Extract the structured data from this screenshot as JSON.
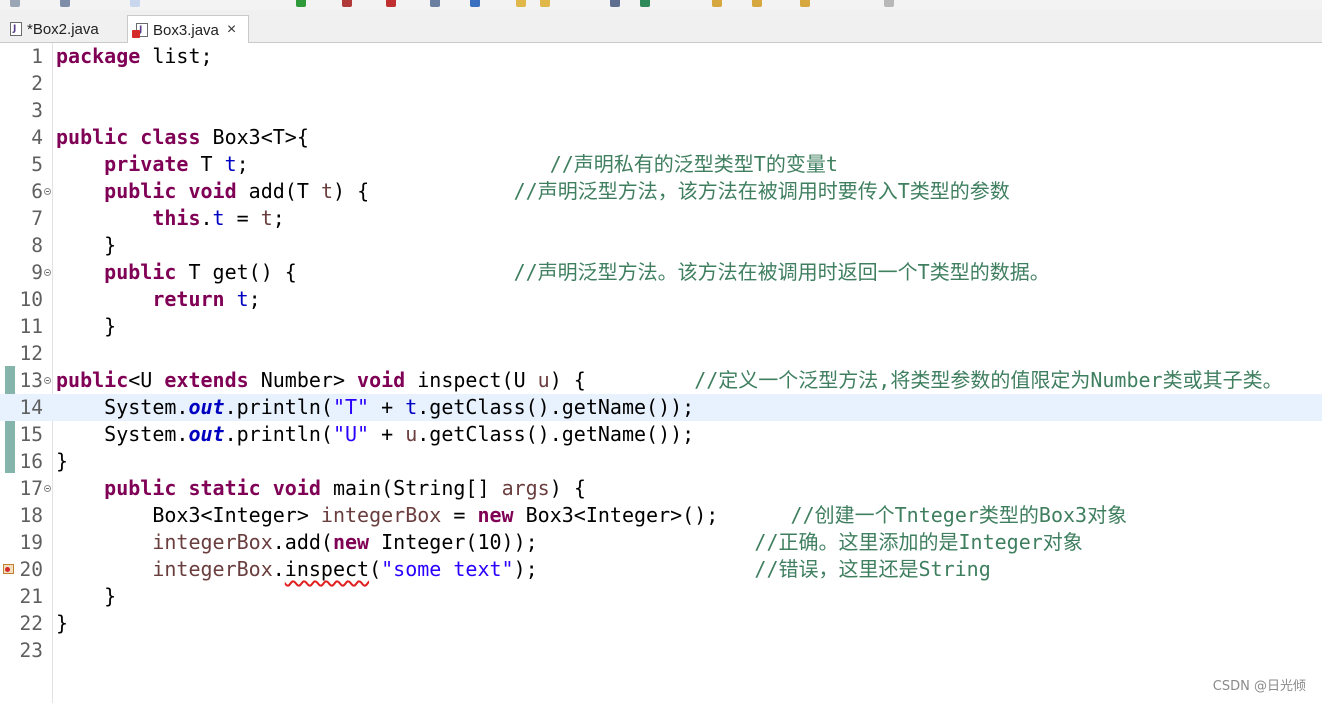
{
  "tabs": [
    {
      "label": "*Box2.java",
      "active": false
    },
    {
      "label": "Box3.java",
      "active": true,
      "close": "×"
    }
  ],
  "watermark": "CSDN @日光倾",
  "colors": {
    "keyword": "#7f0055",
    "comment": "#3f7f5f",
    "string": "#2a00ff",
    "field": "#0000c0",
    "current_line": "#e8f2fe"
  },
  "editor": {
    "lines": [
      {
        "n": "1",
        "code": [
          {
            "t": "package",
            "c": "kw"
          },
          {
            "t": " list;"
          }
        ]
      },
      {
        "n": "2",
        "code": []
      },
      {
        "n": "3",
        "code": []
      },
      {
        "n": "4",
        "code": [
          {
            "t": "public",
            "c": "kw"
          },
          {
            "t": " "
          },
          {
            "t": "class",
            "c": "kw"
          },
          {
            "t": " Box3<T>{"
          }
        ]
      },
      {
        "n": "5",
        "code": [
          {
            "t": "    "
          },
          {
            "t": "private",
            "c": "kw"
          },
          {
            "t": " T "
          },
          {
            "t": "t",
            "c": "field"
          },
          {
            "t": ";                         "
          },
          {
            "t": "//声明私有的泛型类型T的变量t",
            "c": "cmt"
          }
        ]
      },
      {
        "n": "6",
        "fold": true,
        "code": [
          {
            "t": "    "
          },
          {
            "t": "public",
            "c": "kw"
          },
          {
            "t": " "
          },
          {
            "t": "void",
            "c": "kw"
          },
          {
            "t": " add(T "
          },
          {
            "t": "t",
            "c": "local"
          },
          {
            "t": ") {            "
          },
          {
            "t": "//声明泛型方法，该方法在被调用时要传入T类型的参数",
            "c": "cmt"
          }
        ]
      },
      {
        "n": "7",
        "code": [
          {
            "t": "        "
          },
          {
            "t": "this",
            "c": "kw"
          },
          {
            "t": "."
          },
          {
            "t": "t",
            "c": "field"
          },
          {
            "t": " = "
          },
          {
            "t": "t",
            "c": "local"
          },
          {
            "t": ";"
          }
        ]
      },
      {
        "n": "8",
        "code": [
          {
            "t": "    }"
          }
        ]
      },
      {
        "n": "9",
        "fold": true,
        "code": [
          {
            "t": "    "
          },
          {
            "t": "public",
            "c": "kw"
          },
          {
            "t": " T get() {                  "
          },
          {
            "t": "//声明泛型方法。该方法在被调用时返回一个T类型的数据。",
            "c": "cmt"
          }
        ]
      },
      {
        "n": "10",
        "code": [
          {
            "t": "        "
          },
          {
            "t": "return",
            "c": "kw"
          },
          {
            "t": " "
          },
          {
            "t": "t",
            "c": "field"
          },
          {
            "t": ";"
          }
        ]
      },
      {
        "n": "11",
        "code": [
          {
            "t": "    }"
          }
        ]
      },
      {
        "n": "12",
        "code": []
      },
      {
        "n": "13",
        "fold": true,
        "code": [
          {
            "t": "public",
            "c": "kw"
          },
          {
            "t": "<U "
          },
          {
            "t": "extends",
            "c": "kw"
          },
          {
            "t": " Number> "
          },
          {
            "t": "void",
            "c": "kw"
          },
          {
            "t": " inspect(U "
          },
          {
            "t": "u",
            "c": "local"
          },
          {
            "t": ") {         "
          },
          {
            "t": "//定义一个泛型方法,将类型参数的值限定为Number类或其子类。",
            "c": "cmt"
          }
        ]
      },
      {
        "n": "14",
        "current": true,
        "code": [
          {
            "t": "    System."
          },
          {
            "t": "out",
            "c": "sfield"
          },
          {
            "t": ".println("
          },
          {
            "t": "\"T\"",
            "c": "str"
          },
          {
            "t": " + "
          },
          {
            "t": "t",
            "c": "field"
          },
          {
            "t": ".getClass().getName());"
          }
        ]
      },
      {
        "n": "15",
        "code": [
          {
            "t": "    System."
          },
          {
            "t": "out",
            "c": "sfield"
          },
          {
            "t": ".println("
          },
          {
            "t": "\"U\"",
            "c": "str"
          },
          {
            "t": " + "
          },
          {
            "t": "u",
            "c": "local"
          },
          {
            "t": ".getClass().getName());"
          }
        ]
      },
      {
        "n": "16",
        "code": [
          {
            "t": "}"
          }
        ]
      },
      {
        "n": "17",
        "fold": true,
        "code": [
          {
            "t": "    "
          },
          {
            "t": "public",
            "c": "kw"
          },
          {
            "t": " "
          },
          {
            "t": "static",
            "c": "kw"
          },
          {
            "t": " "
          },
          {
            "t": "void",
            "c": "kw"
          },
          {
            "t": " main(String[] "
          },
          {
            "t": "args",
            "c": "local"
          },
          {
            "t": ") {"
          }
        ]
      },
      {
        "n": "18",
        "code": [
          {
            "t": "        Box3<Integer> "
          },
          {
            "t": "integerBox",
            "c": "local"
          },
          {
            "t": " = "
          },
          {
            "t": "new",
            "c": "kw"
          },
          {
            "t": " Box3<Integer>();      "
          },
          {
            "t": "//创建一个Tnteger类型的Box3对象",
            "c": "cmt"
          }
        ]
      },
      {
        "n": "19",
        "code": [
          {
            "t": "        "
          },
          {
            "t": "integerBox",
            "c": "local"
          },
          {
            "t": ".add("
          },
          {
            "t": "new",
            "c": "kw"
          },
          {
            "t": " Integer(10));                  "
          },
          {
            "t": "//正确。这里添加的是Integer对象",
            "c": "cmt"
          }
        ]
      },
      {
        "n": "20",
        "code": [
          {
            "t": "        "
          },
          {
            "t": "integerBox",
            "c": "local"
          },
          {
            "t": "."
          },
          {
            "t": "inspect",
            "c": "err-under"
          },
          {
            "t": "("
          },
          {
            "t": "\"some text\"",
            "c": "str"
          },
          {
            "t": ");                  "
          },
          {
            "t": "//错误，这里还是String",
            "c": "cmt"
          }
        ]
      },
      {
        "n": "21",
        "code": [
          {
            "t": "    }"
          }
        ]
      },
      {
        "n": "22",
        "code": [
          {
            "t": "}"
          }
        ]
      },
      {
        "n": "23",
        "code": []
      }
    ]
  }
}
